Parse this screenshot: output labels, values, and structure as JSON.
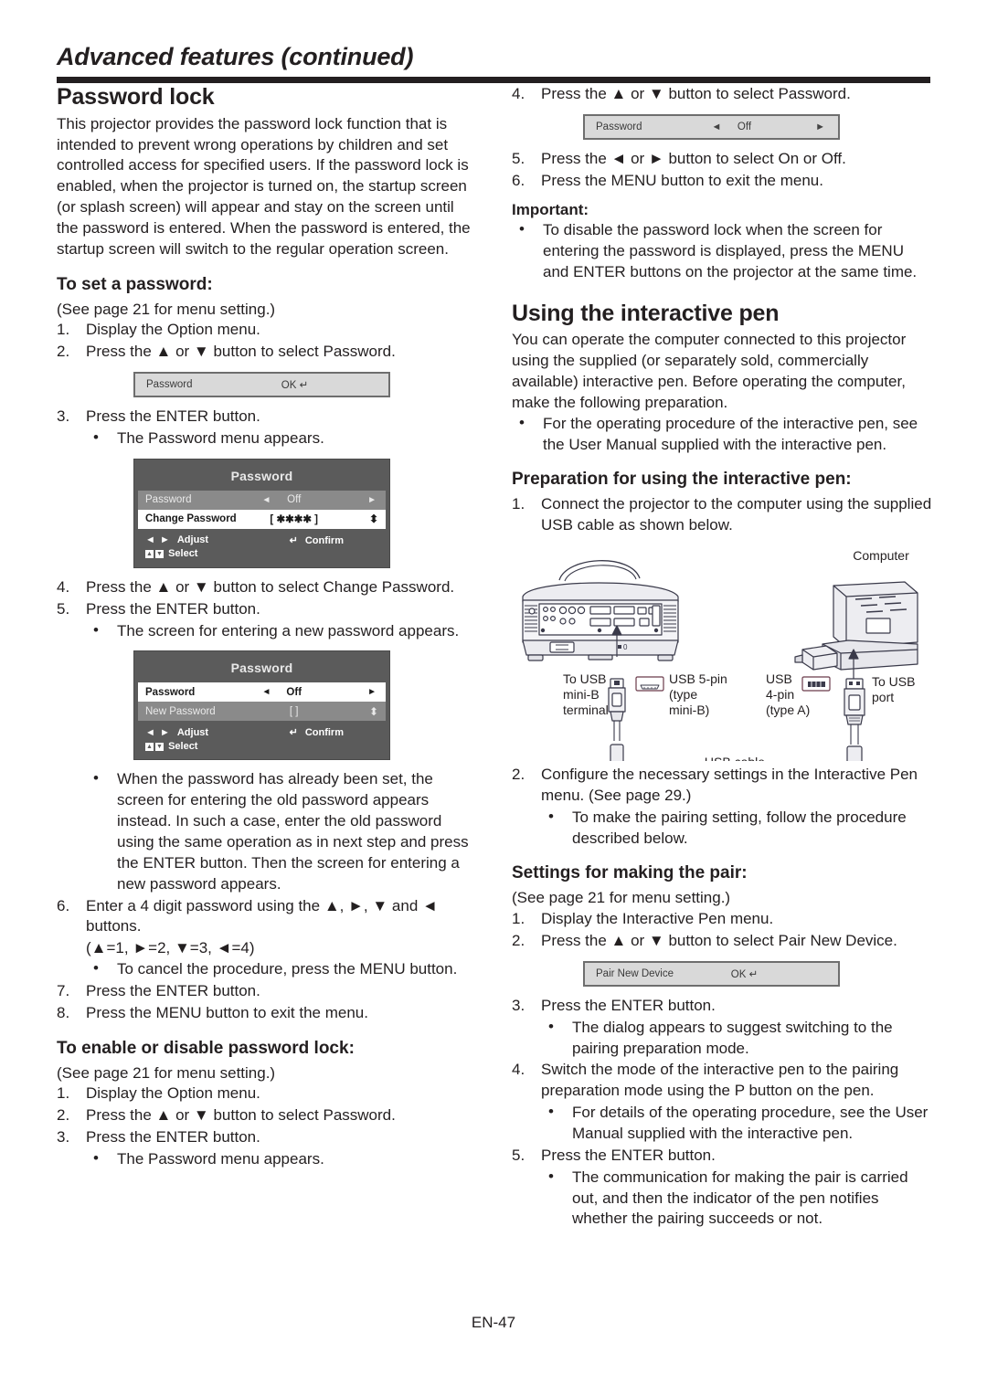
{
  "header": {
    "title": "Advanced features (continued)"
  },
  "footer": {
    "page_number": "EN-47"
  },
  "left_column": {
    "section_title": "Password lock",
    "intro": "This projector provides the password lock function that is intended to prevent wrong operations by children and set controlled access for specified users. If the password lock is enabled, when the projector is turned on, the startup screen (or splash screen) will appear and stay on the screen until the password is entered. When the password is entered, the startup screen will switch to the regular operation screen.",
    "set_password": {
      "heading": "To set a password:",
      "note": "(See page 21 for menu setting.)",
      "steps_1_2": [
        {
          "num": "1.",
          "text": "Display the Option menu."
        },
        {
          "num": "2.",
          "text": "Press the ▲ or ▼ button to select Password."
        }
      ],
      "osd_bar_1": {
        "label": "Password",
        "value": "OK ↵"
      },
      "steps_3": [
        {
          "num": "3.",
          "text": "Press the ENTER button."
        }
      ],
      "bullet_3": "The Password menu appears.",
      "osd_menu_1": {
        "title": "Password",
        "rows": [
          {
            "label": "Password",
            "value": "Off",
            "style": "dim",
            "left_arrow": "◄",
            "right_arrow": "►"
          },
          {
            "label": "Change Password",
            "value": "[ ✱✱✱✱ ]",
            "style": "sel",
            "updown": "⬍"
          }
        ],
        "footer": {
          "adjust": "Adjust",
          "adjust_keys": "◄ ►",
          "confirm": "Confirm",
          "confirm_key": "↵",
          "select": "Select",
          "select_keys": "▲ ▼"
        }
      },
      "steps_4_5": [
        {
          "num": "4.",
          "text": "Press the ▲ or ▼ button to select Change Password."
        },
        {
          "num": "5.",
          "text": "Press the ENTER button."
        }
      ],
      "bullet_5": "The screen for entering a new password appears.",
      "osd_menu_2": {
        "title": "Password",
        "rows": [
          {
            "label": "Password",
            "value": "Off",
            "style": "sel",
            "left_arrow": "◄",
            "right_arrow": "►"
          },
          {
            "label": "New Password",
            "value": "[           ]",
            "style": "dim",
            "updown": "⬍"
          }
        ],
        "footer": {
          "adjust": "Adjust",
          "adjust_keys": "◄ ►",
          "confirm": "Confirm",
          "confirm_key": "↵",
          "select": "Select",
          "select_keys": "▲ ▼"
        }
      },
      "bullet_old_password": "When the password has already been set, the screen for entering the old password appears instead. In such a case, enter the old password using the same operation as in next step and press the ENTER button. Then the screen for entering a new password appears.",
      "step_6": {
        "num": "6.",
        "text": "Enter a 4 digit password using the ▲, ►, ▼ and ◄ buttons."
      },
      "arrow_map": "(▲=1, ►=2, ▼=3, ◄=4)",
      "bullet_cancel": "To cancel the procedure, press the MENU button.",
      "steps_7_8": [
        {
          "num": "7.",
          "text": "Press the ENTER button."
        },
        {
          "num": "8.",
          "text": "Press the MENU button to exit the menu."
        }
      ]
    },
    "enable_disable": {
      "heading": "To enable or disable password lock:",
      "note": "(See page 21 for menu setting.)",
      "steps": [
        {
          "num": "1.",
          "text": "Display the Option menu."
        },
        {
          "num": "2.",
          "text": "Press the ▲ or ▼ button to select Password."
        },
        {
          "num": "3.",
          "text": "Press the ENTER button."
        }
      ],
      "bullet": "The Password menu appears."
    }
  },
  "right_column": {
    "step_4": {
      "num": "4.",
      "text": "Press the ▲ or ▼ button to select Password."
    },
    "osd_bar_2": {
      "label": "Password",
      "value": "Off",
      "left_arrow": "◄",
      "right_arrow": "►"
    },
    "steps_5_6": [
      {
        "num": "5.",
        "text": "Press the ◄ or ► button to select On or Off."
      },
      {
        "num": "6.",
        "text": "Press the MENU button to exit the menu."
      }
    ],
    "important": {
      "heading": "Important:",
      "bullet": "To disable the password lock when the screen for entering the password is displayed, press the MENU and ENTER buttons on the projector at the same time."
    },
    "interactive_pen": {
      "section_title": "Using the interactive pen",
      "intro": "You can operate the computer connected to this projector using the supplied (or separately sold, commercially available) interactive pen. Before operating the computer, make the following preparation.",
      "bullet": "For the operating procedure of the interactive pen, see the User Manual supplied with the interactive pen.",
      "preparation_heading": "Preparation for using the interactive pen:",
      "step_1": {
        "num": "1.",
        "text": "Connect the projector to the computer using the supplied USB cable as shown below."
      },
      "diagram": {
        "computer_label": "Computer",
        "to_usb_mini_b": "To USB\nmini-B\nterminal",
        "to_usb_mini_b_lines": [
          "To USB",
          "mini-B",
          "terminal"
        ],
        "usb_5pin_lines": [
          "USB 5-pin",
          "(type",
          "mini-B)"
        ],
        "usb_4pin_lines": [
          "USB",
          "4-pin",
          "(type A)"
        ],
        "to_usb_port_lines": [
          "To USB",
          "port"
        ],
        "usb_cable_label": "USB cable"
      },
      "step_2": {
        "num": "2.",
        "text": "Configure the necessary settings in the Interactive Pen menu. (See page 29.)"
      },
      "bullet_2": "To make the pairing setting, follow the procedure described below.",
      "pair_heading": "Settings for making the pair:",
      "pair_note": "(See page 21 for menu setting.)",
      "pair_steps_1_2": [
        {
          "num": "1.",
          "text": "Display the Interactive Pen menu."
        },
        {
          "num": "2.",
          "text": "Press the ▲ or ▼ button to select Pair New Device."
        }
      ],
      "osd_bar_3": {
        "label": "Pair New Device",
        "value": "OK ↵"
      },
      "step_3": {
        "num": "3.",
        "text": "Press the ENTER button."
      },
      "bullet_3": "The dialog appears to suggest switching to the pairing preparation mode.",
      "step_4b": {
        "num": "4.",
        "text": "Switch the mode of the interactive pen to the pairing preparation mode using the P button on the pen."
      },
      "bullet_4": "For details of the operating procedure, see the User Manual supplied with the interactive pen.",
      "step_5": {
        "num": "5.",
        "text": "Press the ENTER button."
      },
      "bullet_5": "The communication for making the pair is carried out, and then the indicator of the pen notifies whether the pairing succeeds or not."
    }
  },
  "colors": {
    "ink": "#231f20",
    "osd_menu_bg": "#5b5b5b",
    "osd_row_dim": "#8a8a8a",
    "osd_row_selected": "#ffffff",
    "osd_bar_bg": "#d9d9d9",
    "osd_bar_border": "#6e6e6e"
  }
}
